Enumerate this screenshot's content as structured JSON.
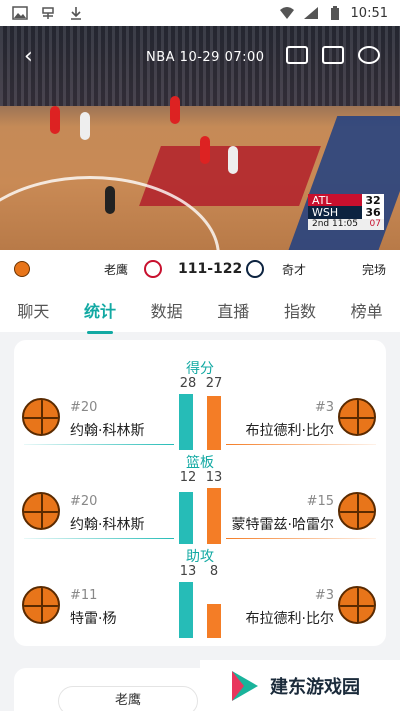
{
  "statusbar": {
    "time": "10:51",
    "icons": [
      "image-icon",
      "app-icon",
      "download-icon",
      "wifi-icon",
      "signal-icon",
      "battery-icon"
    ]
  },
  "video": {
    "title": "NBA  10-29 07:00",
    "scoreboard": {
      "home_abbr": "ATL",
      "home_pts": "32",
      "away_abbr": "WSH",
      "away_pts": "36",
      "period": "2nd 11:05",
      "shot_clock": "07"
    }
  },
  "match": {
    "home_name": "老鹰",
    "score": "111-122",
    "away_name": "奇才",
    "status": "完场"
  },
  "tabs": [
    "聊天",
    "统计",
    "数据",
    "直播",
    "指数",
    "榜单"
  ],
  "active_tab": 1,
  "stats": [
    {
      "title": "得分",
      "left_val": 28,
      "right_val": 27,
      "left": {
        "num": "#20",
        "name": "约翰·科林斯"
      },
      "right": {
        "num": "#3",
        "name": "布拉德利·比尔"
      }
    },
    {
      "title": "篮板",
      "left_val": 12,
      "right_val": 13,
      "left": {
        "num": "#20",
        "name": "约翰·科林斯"
      },
      "right": {
        "num": "#15",
        "name": "蒙特雷兹·哈雷尔"
      }
    },
    {
      "title": "助攻",
      "left_val": 13,
      "right_val": 8,
      "left": {
        "num": "#11",
        "name": "特雷·杨"
      },
      "right": {
        "num": "#3",
        "name": "布拉德利·比尔"
      }
    }
  ],
  "bottom": {
    "pill_label": "老鹰"
  },
  "watermark": {
    "text": "建东游戏园"
  },
  "colors": {
    "accent": "#12a9a3",
    "home_bar": "#26bcb7",
    "away_bar": "#f47d26"
  }
}
